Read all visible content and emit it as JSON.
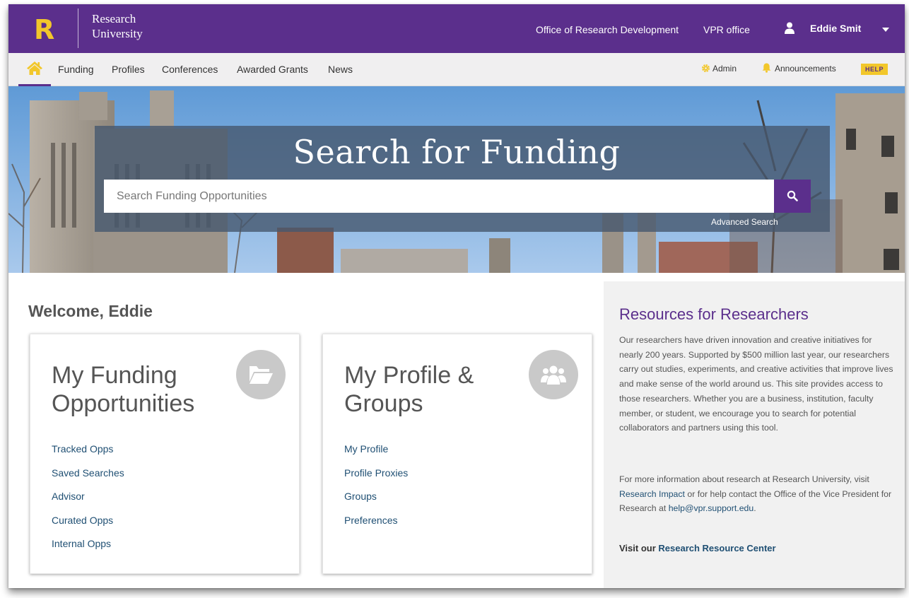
{
  "brand": {
    "logo_letter": "R",
    "name_line1": "Research",
    "name_line2": "University",
    "purple": "#5b2f8c",
    "gold": "#f2c72b"
  },
  "header": {
    "links": [
      "Office of Research Development",
      "VPR office"
    ],
    "user_name": "Eddie Smit"
  },
  "nav": {
    "items": [
      "Funding",
      "Profiles",
      "Conferences",
      "Awarded Grants",
      "News"
    ],
    "admin": "Admin",
    "announcements": "Announcements",
    "help": "HELP"
  },
  "hero": {
    "title": "Search for Funding",
    "placeholder": "Search Funding Opportunities",
    "advanced": "Advanced Search"
  },
  "welcome": "Welcome, Eddie",
  "cards": [
    {
      "title_line1": "My Funding",
      "title_line2": "Opportunities",
      "icon": "folder-open-icon",
      "links": [
        "Tracked Opps",
        "Saved Searches",
        "Advisor",
        "Curated Opps",
        "Internal Opps"
      ]
    },
    {
      "title_line1": "My Profile &",
      "title_line2": "Groups",
      "icon": "users-icon",
      "links": [
        "My Profile",
        "Profile Proxies",
        "Groups",
        "Preferences"
      ]
    }
  ],
  "resources": {
    "title": "Resources for Researchers",
    "body": "Our researchers have driven innovation and creative initiatives for nearly 200 years. Supported by $500 million last year, our researchers carry out studies, experiments, and creative activities that improve lives and make sense of the world around us. This site provides access to those researchers. Whether you are a business, institution, faculty member, or student, we encourage you to search for potential collaborators and partners using this tool.",
    "more_prefix": "For more information about research at Research University, visit ",
    "impact_link": "Research Impact",
    "more_middle": " or for help contact the Office of the Vice President for Research at ",
    "email": "help@vpr.support.edu",
    "more_suffix": ".",
    "visit_prefix": "Visit our ",
    "center_link": "Research Resource Center"
  }
}
